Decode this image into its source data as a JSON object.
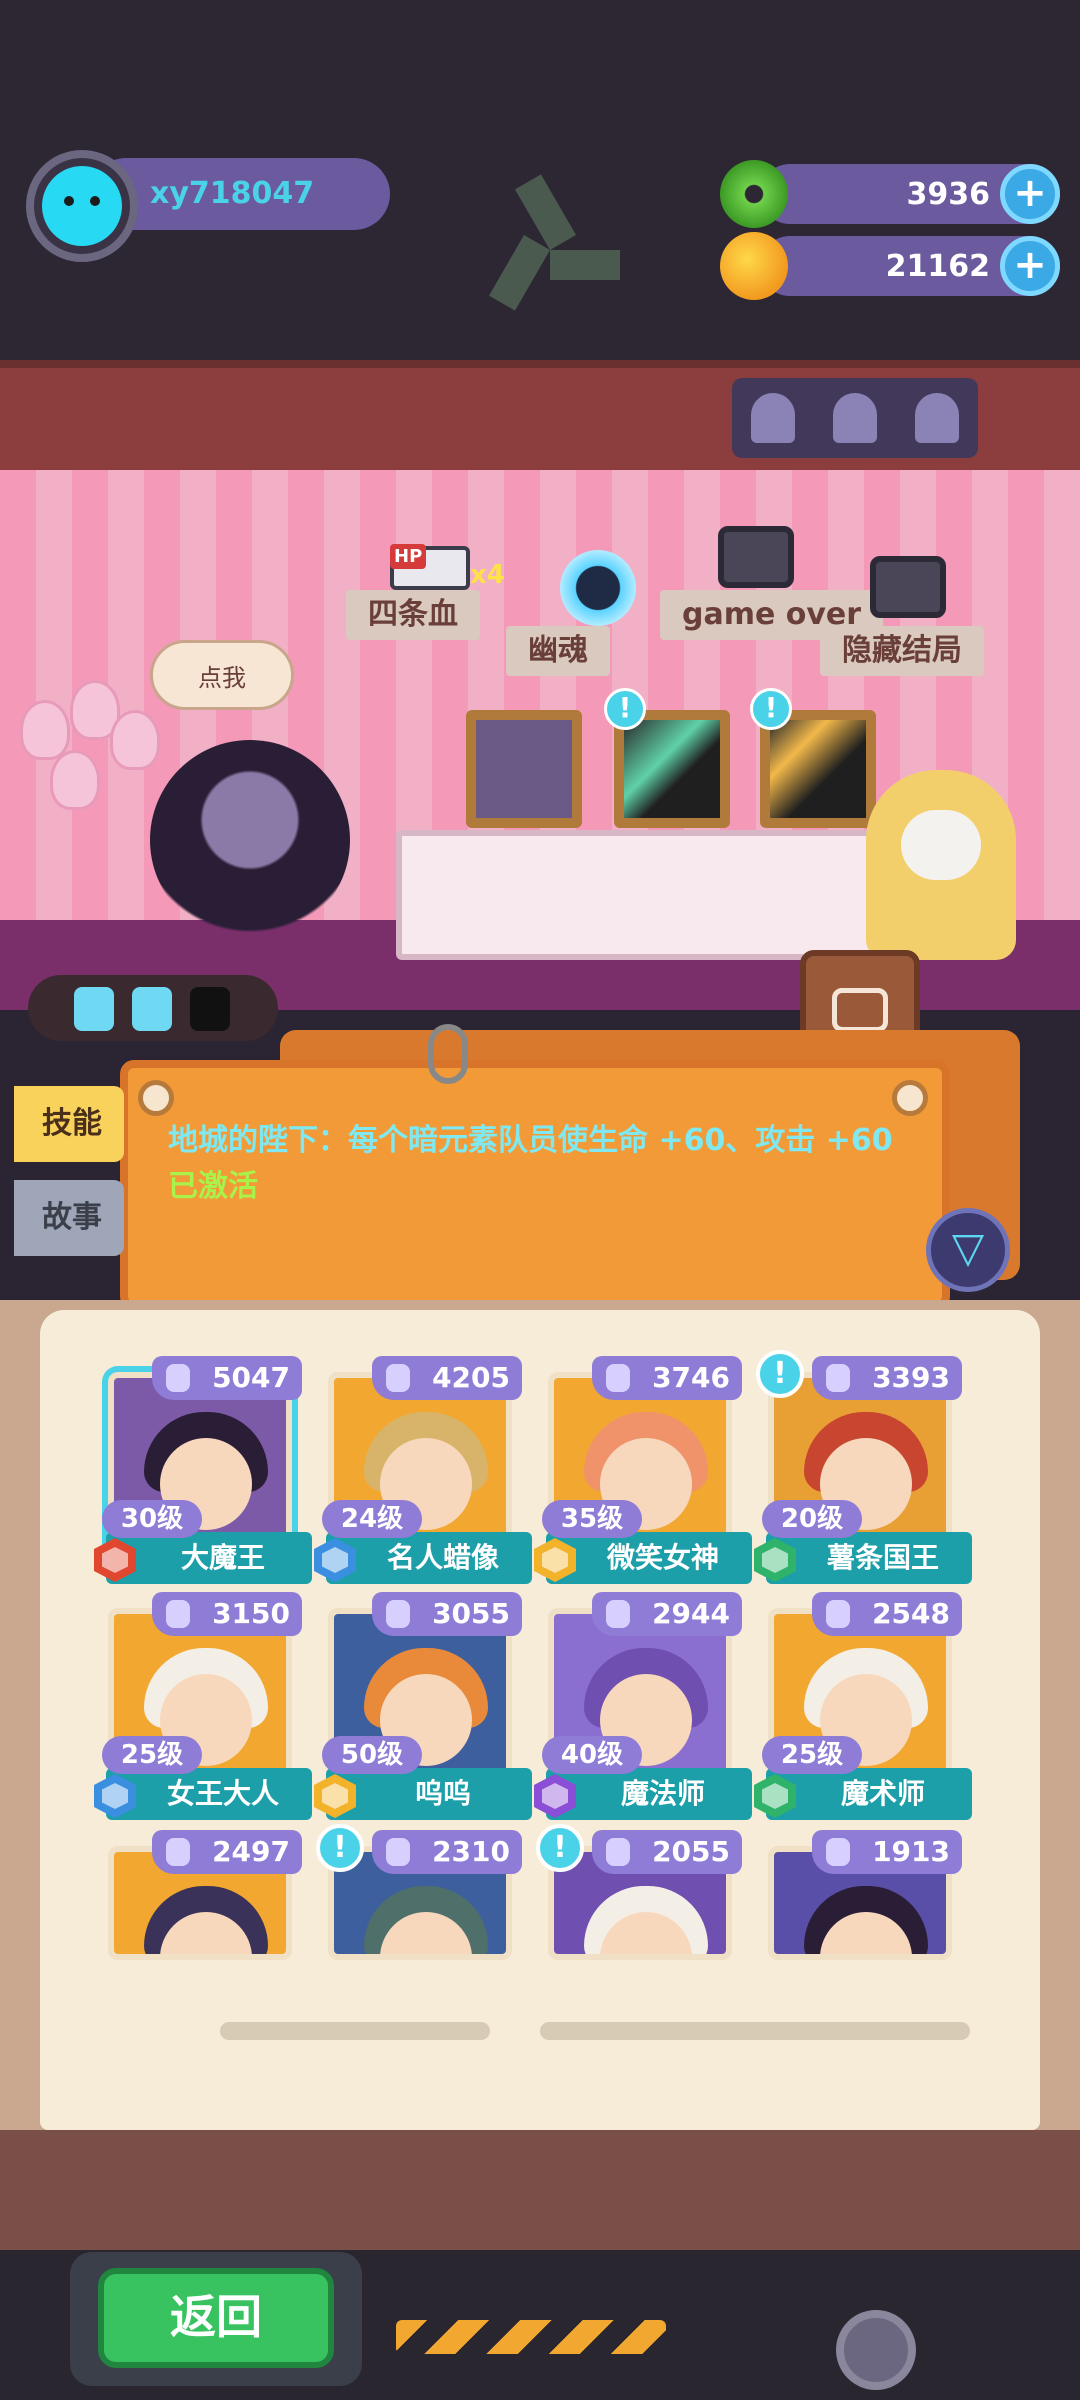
{
  "user": {
    "name": "xy718047"
  },
  "currencies": [
    {
      "name": "donut",
      "icon": "donut-icon",
      "value": "3936"
    },
    {
      "name": "coin",
      "icon": "planet-coin-icon",
      "value": "21162"
    }
  ],
  "room": {
    "items": [
      {
        "label": "四条血",
        "badge": "HP",
        "count": "x4"
      },
      {
        "label": "幽魂"
      },
      {
        "label": "game over"
      },
      {
        "label": "隐藏结局"
      }
    ],
    "speech": "点我"
  },
  "energy": {
    "filled": 2,
    "total": 3
  },
  "tabs": {
    "skill": "技能",
    "story": "故事"
  },
  "skill_text": {
    "main": "地城的陛下：每个暗元素队员使生命 +60、攻击 +60",
    "status": "已激活"
  },
  "characters": [
    {
      "name": "大魔王",
      "level": "30级",
      "power": "5047",
      "element": "#e0472e",
      "hair": "#2a1e36",
      "bg": "#7c5aa8",
      "selected": true,
      "alert": false
    },
    {
      "name": "名人蜡像",
      "level": "24级",
      "power": "4205",
      "element": "#3a8fe0",
      "hair": "#d8b46a",
      "bg": "#f2a830",
      "selected": false,
      "alert": false
    },
    {
      "name": "微笑女神",
      "level": "35级",
      "power": "3746",
      "element": "#f2b22a",
      "hair": "#f0936a",
      "bg": "#f2a830",
      "selected": false,
      "alert": false
    },
    {
      "name": "薯条国王",
      "level": "20级",
      "power": "3393",
      "element": "#2fb36a",
      "hair": "#c8452f",
      "bg": "#e8a035",
      "selected": false,
      "alert": true
    },
    {
      "name": "女王大人",
      "level": "25级",
      "power": "3150",
      "element": "#3a8fe0",
      "hair": "#f4efe6",
      "bg": "#f2a830",
      "selected": false,
      "alert": false
    },
    {
      "name": "呜呜",
      "level": "50级",
      "power": "3055",
      "element": "#f2b22a",
      "hair": "#e98a3a",
      "bg": "#3d5f9e",
      "selected": false,
      "alert": false
    },
    {
      "name": "魔法师",
      "level": "40级",
      "power": "2944",
      "element": "#8a4fd6",
      "hair": "#6f4fb0",
      "bg": "#8a6fd0",
      "selected": false,
      "alert": false
    },
    {
      "name": "魔术师",
      "level": "25级",
      "power": "2548",
      "element": "#2fb36a",
      "hair": "#f4efe6",
      "bg": "#f2a830",
      "selected": false,
      "alert": false
    },
    {
      "name": "",
      "level": "",
      "power": "2497",
      "element": "",
      "hair": "#3a3258",
      "bg": "#f2a830",
      "selected": false,
      "alert": false,
      "partial": true
    },
    {
      "name": "",
      "level": "",
      "power": "2310",
      "element": "",
      "hair": "#4f6f6a",
      "bg": "#3d5f9e",
      "selected": false,
      "alert": true,
      "partial": true
    },
    {
      "name": "",
      "level": "",
      "power": "2055",
      "element": "",
      "hair": "#f4efe6",
      "bg": "#6f4fb0",
      "selected": false,
      "alert": true,
      "partial": true
    },
    {
      "name": "",
      "level": "",
      "power": "1913",
      "element": "",
      "hair": "#2a1e36",
      "bg": "#5a4fa8",
      "selected": false,
      "alert": false,
      "partial": true
    }
  ],
  "back_button": "返回"
}
